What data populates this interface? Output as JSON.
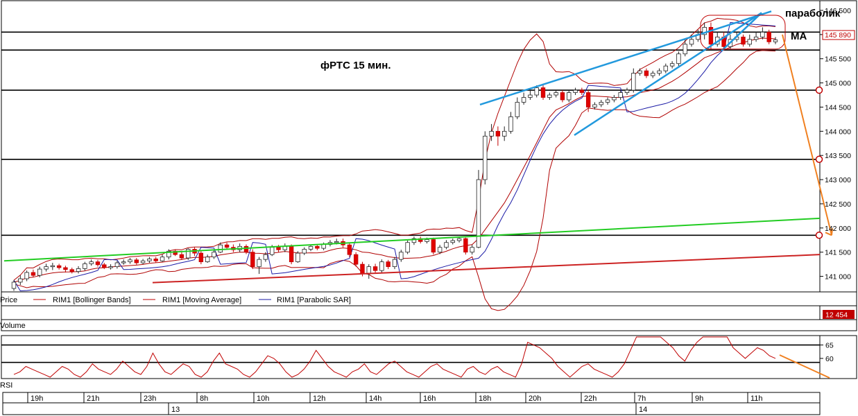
{
  "chart_data": [
    {
      "type": "candlestick",
      "title": "фРТС   15 мин.",
      "annotations": [
        "параболик",
        "MA"
      ],
      "y_ticks": [
        "146 500",
        "146 000",
        "145 500",
        "145 000",
        "144 500",
        "144 000",
        "143 500",
        "143 000",
        "142 500",
        "142 000",
        "141 500",
        "141 000"
      ],
      "ylim": [
        140750,
        146600
      ],
      "last_price": "145 890",
      "legend": [
        "Price",
        "RIM1 [Bollinger Bands]",
        "RIM1 [Moving Average]",
        "RIM1 [Parabolic SAR]"
      ],
      "grid": false,
      "horizontal_levels": [
        146050,
        145680,
        144850,
        143420,
        141850
      ],
      "candles": [
        [
          140750,
          140880,
          140700,
          140920
        ],
        [
          140880,
          140950,
          140820,
          141020
        ],
        [
          140950,
          141080,
          140900,
          141120
        ],
        [
          141080,
          141020,
          140980,
          141140
        ],
        [
          141020,
          141150,
          140980,
          141200
        ],
        [
          141150,
          141200,
          141100,
          141260
        ],
        [
          141200,
          141220,
          141130,
          141280
        ],
        [
          141220,
          141180,
          141140,
          141260
        ],
        [
          141180,
          141140,
          141080,
          141220
        ],
        [
          141140,
          141100,
          141060,
          141180
        ],
        [
          141100,
          141160,
          141060,
          141210
        ],
        [
          141160,
          141260,
          141120,
          141300
        ],
        [
          141260,
          141300,
          141220,
          141350
        ],
        [
          141300,
          141240,
          141200,
          141340
        ],
        [
          141240,
          141180,
          141150,
          141280
        ],
        [
          141180,
          141200,
          141140,
          141250
        ],
        [
          141200,
          141280,
          141160,
          141320
        ],
        [
          141280,
          141300,
          141240,
          141350
        ],
        [
          141300,
          141340,
          141260,
          141380
        ],
        [
          141340,
          141280,
          141240,
          141380
        ],
        [
          141280,
          141320,
          141250,
          141360
        ],
        [
          141320,
          141360,
          141280,
          141400
        ],
        [
          141360,
          141320,
          141280,
          141400
        ],
        [
          141320,
          141400,
          141300,
          141450
        ],
        [
          141400,
          141520,
          141350,
          141560
        ],
        [
          141520,
          141450,
          141420,
          141560
        ],
        [
          141450,
          141380,
          141340,
          141500
        ],
        [
          141380,
          141560,
          141340,
          141580
        ],
        [
          141560,
          141480,
          141420,
          141600
        ],
        [
          141480,
          141300,
          141250,
          141520
        ],
        [
          141300,
          141400,
          141280,
          141450
        ],
        [
          141400,
          141500,
          141360,
          141560
        ],
        [
          141500,
          141650,
          141480,
          141700
        ],
        [
          141650,
          141600,
          141560,
          141700
        ],
        [
          141600,
          141550,
          141500,
          141660
        ],
        [
          141550,
          141620,
          141500,
          141680
        ],
        [
          141620,
          141500,
          141460,
          141660
        ],
        [
          141500,
          141200,
          141150,
          141560
        ],
        [
          141200,
          141350,
          141050,
          141400
        ],
        [
          141350,
          141450,
          141300,
          141500
        ],
        [
          141450,
          141600,
          141420,
          141650
        ],
        [
          141600,
          141550,
          141500,
          141650
        ],
        [
          141550,
          141620,
          141500,
          141680
        ],
        [
          141620,
          141300,
          141250,
          141660
        ],
        [
          141300,
          141480,
          141280,
          141520
        ],
        [
          141480,
          141560,
          141440,
          141600
        ],
        [
          141560,
          141620,
          141520,
          141660
        ],
        [
          141620,
          141580,
          141540,
          141660
        ],
        [
          141580,
          141660,
          141540,
          141700
        ],
        [
          141660,
          141700,
          141620,
          141750
        ],
        [
          141700,
          141720,
          141660,
          141780
        ],
        [
          141720,
          141650,
          141600,
          141780
        ],
        [
          141650,
          141450,
          141400,
          141700
        ],
        [
          141450,
          141250,
          141200,
          141500
        ],
        [
          141250,
          141050,
          141000,
          141300
        ],
        [
          141050,
          141200,
          140950,
          141250
        ],
        [
          141200,
          141120,
          141080,
          141260
        ],
        [
          141120,
          141300,
          141080,
          141350
        ],
        [
          141300,
          141200,
          141150,
          141340
        ],
        [
          141200,
          141350,
          141150,
          141400
        ],
        [
          141350,
          141500,
          141300,
          141550
        ],
        [
          141500,
          141700,
          141460,
          141740
        ],
        [
          141700,
          141780,
          141650,
          141820
        ],
        [
          141780,
          141720,
          141680,
          141820
        ],
        [
          141720,
          141760,
          141680,
          141800
        ],
        [
          141760,
          141500,
          141450,
          141800
        ],
        [
          141500,
          141600,
          141460,
          141650
        ],
        [
          141600,
          141700,
          141560,
          141750
        ],
        [
          141700,
          141740,
          141660,
          141780
        ],
        [
          141740,
          141780,
          141700,
          141820
        ],
        [
          141780,
          141500,
          141450,
          141800
        ],
        [
          141500,
          141600,
          141450,
          141650
        ],
        [
          141600,
          143000,
          141580,
          143200
        ],
        [
          143000,
          143900,
          142900,
          144000
        ],
        [
          143900,
          144000,
          143800,
          144150
        ],
        [
          144000,
          143900,
          143700,
          144100
        ],
        [
          143900,
          144000,
          143800,
          144100
        ],
        [
          144000,
          144300,
          143950,
          144400
        ],
        [
          144300,
          144600,
          144250,
          144700
        ],
        [
          144600,
          144700,
          144550,
          144800
        ],
        [
          144700,
          144750,
          144650,
          144850
        ],
        [
          144750,
          144900,
          144700,
          144950
        ],
        [
          144900,
          144700,
          144650,
          144950
        ],
        [
          144700,
          144750,
          144650,
          144800
        ],
        [
          144750,
          144800,
          144700,
          144850
        ],
        [
          144800,
          144650,
          144600,
          144850
        ],
        [
          144650,
          144800,
          144600,
          144850
        ],
        [
          144800,
          144850,
          144750,
          144900
        ],
        [
          144850,
          144800,
          144750,
          144900
        ],
        [
          144800,
          144500,
          144400,
          144850
        ],
        [
          144500,
          144550,
          144450,
          144600
        ],
        [
          144550,
          144600,
          144500,
          144650
        ],
        [
          144600,
          144650,
          144550,
          144700
        ],
        [
          144650,
          144700,
          144600,
          144750
        ],
        [
          144700,
          144800,
          144650,
          144850
        ],
        [
          144800,
          144850,
          144750,
          144900
        ],
        [
          144850,
          145200,
          144800,
          145300
        ],
        [
          145200,
          145250,
          145150,
          145300
        ],
        [
          145250,
          145150,
          145100,
          145300
        ],
        [
          145150,
          145200,
          145100,
          145250
        ],
        [
          145200,
          145250,
          145150,
          145300
        ],
        [
          145250,
          145350,
          145200,
          145400
        ],
        [
          145350,
          145400,
          145300,
          145450
        ],
        [
          145400,
          145600,
          145350,
          145650
        ],
        [
          145600,
          145800,
          145550,
          145900
        ],
        [
          145800,
          145900,
          145750,
          146000
        ],
        [
          145900,
          146000,
          145850,
          146100
        ],
        [
          146000,
          146150,
          145900,
          146250
        ],
        [
          146150,
          145800,
          145700,
          146250
        ],
        [
          145800,
          145950,
          145750,
          146050
        ],
        [
          145950,
          145750,
          145700,
          146050
        ],
        [
          145750,
          145900,
          145700,
          146000
        ],
        [
          145900,
          145950,
          145850,
          146050
        ],
        [
          145950,
          145800,
          145750,
          146000
        ],
        [
          145800,
          145900,
          145750,
          146000
        ],
        [
          145900,
          145950,
          145850,
          146050
        ],
        [
          145950,
          146050,
          145900,
          146150
        ],
        [
          146050,
          145850,
          145800,
          146100
        ],
        [
          145850,
          145890,
          145800,
          145950
        ]
      ]
    },
    {
      "type": "line",
      "title": "RSI",
      "y_ticks": [
        "65",
        "60"
      ],
      "ylim": [
        53,
        68
      ],
      "levels": [
        65,
        58.5
      ],
      "values": [
        54,
        55,
        57,
        56,
        55,
        54,
        53,
        55,
        57,
        56,
        54,
        53,
        55,
        58,
        56,
        55,
        54,
        56,
        59,
        57,
        55,
        54,
        57,
        62,
        58,
        55,
        54,
        56,
        58,
        57,
        54,
        53,
        55,
        59,
        62,
        58,
        57,
        56,
        54,
        53,
        55,
        58,
        61,
        60,
        58,
        55,
        53,
        54,
        56,
        59,
        63,
        60,
        57,
        55,
        54,
        53,
        55,
        56,
        58,
        55,
        54,
        56,
        58,
        59,
        57,
        55,
        54,
        53,
        55,
        57,
        58,
        56,
        55,
        54,
        53,
        56,
        57,
        55,
        54,
        56,
        57,
        55,
        54,
        53,
        58,
        66,
        65,
        64,
        62,
        60,
        57,
        55,
        53,
        55,
        57,
        58,
        56,
        55,
        54,
        53,
        55,
        58,
        63,
        70,
        69,
        72,
        70,
        68,
        66,
        64,
        61,
        59,
        63,
        66,
        69,
        71,
        73,
        72,
        68,
        64,
        62,
        60,
        62,
        64,
        63,
        61,
        60
      ]
    },
    {
      "type": "bar",
      "title": "Volume",
      "last_value": "12 454"
    }
  ],
  "time_axis": {
    "hours": [
      "19h",
      "21h",
      "23h",
      "8h",
      "10h",
      "12h",
      "14h",
      "16h",
      "18h",
      "20h",
      "22h",
      "7h",
      "9h",
      "11h"
    ],
    "days": [
      "13",
      "14"
    ]
  }
}
